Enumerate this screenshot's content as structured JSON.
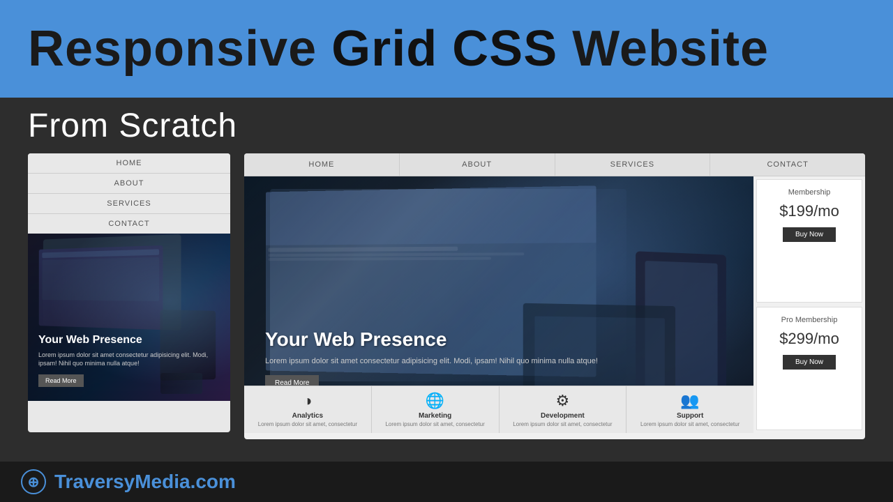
{
  "banner": {
    "title_regular": "Responsive ",
    "title_bold": "Grid CSS",
    "title_rest": " Website"
  },
  "subtitle": "From Scratch",
  "mobile_preview": {
    "nav_items": [
      "HOME",
      "ABOUT",
      "SERVICES",
      "CONTACT"
    ],
    "hero": {
      "title": "Your Web Presence",
      "description": "Lorem ipsum dolor sit amet consectetur adipisicing elit. Modi, ipsam! Nihil quo minima nulla atque!",
      "cta": "Read More"
    }
  },
  "desktop_preview": {
    "nav_items": [
      "HOME",
      "ABOUT",
      "SERVICES",
      "CONTACT"
    ],
    "hero": {
      "title": "Your Web Presence",
      "description": "Lorem ipsum dolor sit amet consectetur adipisicing elit. Modi, ipsam! Nihil quo minima nulla atque!",
      "cta": "Read More"
    },
    "pricing": [
      {
        "title": "Membership",
        "price": "$199/mo",
        "btn": "Buy Now"
      },
      {
        "title": "Pro Membership",
        "price": "$299/mo",
        "btn": "Buy Now"
      }
    ],
    "features": [
      {
        "icon": "◑",
        "name": "Analytics",
        "desc": "Lorem ipsum dolor sit amet, consectetur"
      },
      {
        "icon": "🌐",
        "name": "Marketing",
        "desc": "Lorem ipsum dolor sit amet, consectetur"
      },
      {
        "icon": "⚙",
        "name": "Development",
        "desc": "Lorem ipsum dolor sit amet, consectetur"
      },
      {
        "icon": "👥",
        "name": "Support",
        "desc": "Lorem ipsum dolor sit amet, consectetur"
      }
    ]
  },
  "brand": {
    "logo_char": "⊕",
    "name_regular": "Traversy",
    "name_bold": "Media",
    "domain": ".com"
  },
  "colors": {
    "blue": "#4a90d9",
    "dark": "#2d2d2d",
    "darkest": "#1a1a1a"
  }
}
